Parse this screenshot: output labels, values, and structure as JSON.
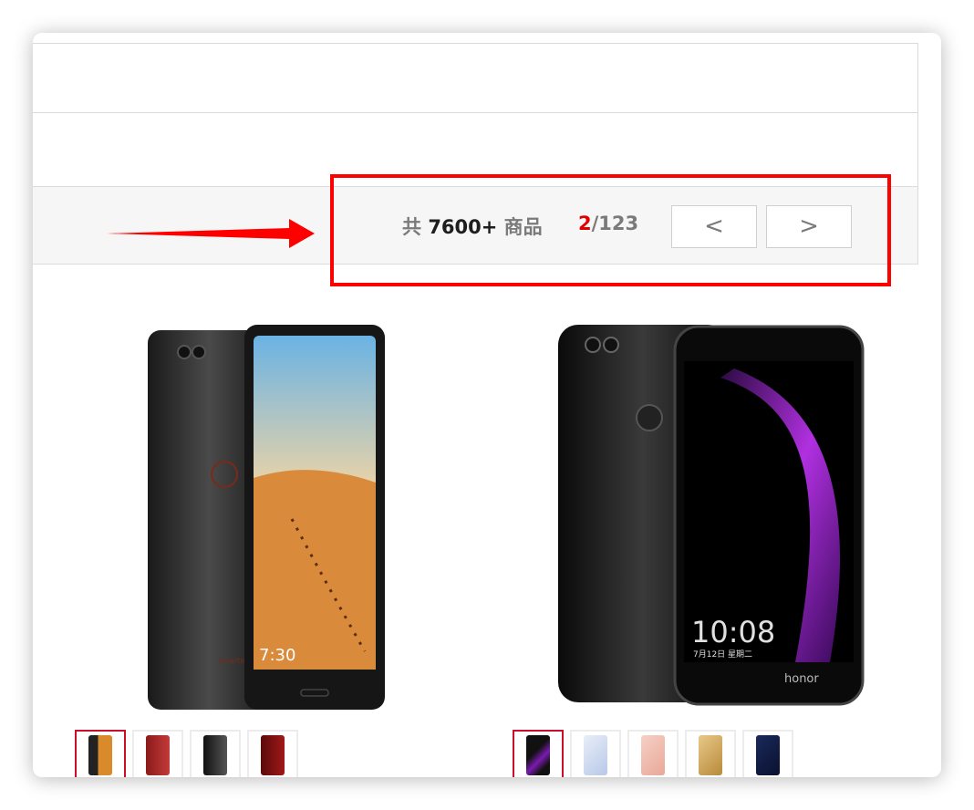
{
  "toolbar": {
    "total_prefix": "共",
    "total_count": "7600+",
    "total_suffix": "商品",
    "current_page": "2",
    "total_pages": "/123",
    "prev_label": "<",
    "next_label": ">"
  },
  "products": [
    {
      "name": "smartisan-phone",
      "screen_time": "7:30",
      "back_brand": "smartisan",
      "thumb_colors": [
        "#d98a2a",
        "#8b1a1a",
        "#2a2a2a",
        "#7a1010"
      ]
    },
    {
      "name": "honor-phone",
      "screen_time": "10:08",
      "screen_date": "7月12日 星期二",
      "brand": "honor",
      "thumb_colors": [
        "#5a1a7a",
        "#dfe8f5",
        "#f0c4b8",
        "#d4a85a",
        "#1a2a5a"
      ]
    }
  ],
  "colors": {
    "accent": "#ff0000",
    "page_current": "#e00000",
    "selected_thumb_border": "#c8102e"
  }
}
